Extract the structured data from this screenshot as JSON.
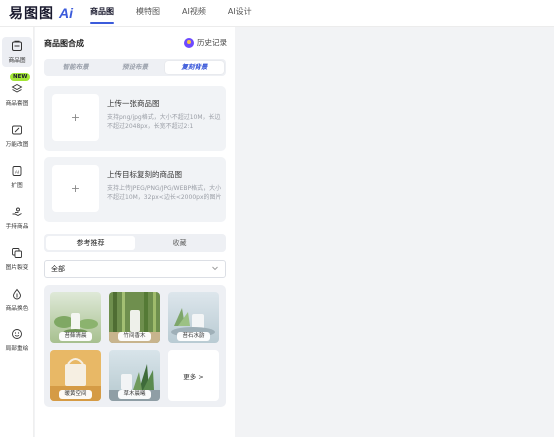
{
  "app": {
    "logo_text": "易图图",
    "logo_ai": "Ai"
  },
  "nav": {
    "items": [
      {
        "label": "商品图",
        "active": true
      },
      {
        "label": "模特图",
        "active": false
      },
      {
        "label": "AI视频",
        "active": false
      },
      {
        "label": "AI设计",
        "active": false
      }
    ]
  },
  "sidebar": {
    "new_badge": "NEW",
    "items": [
      {
        "label": "商品图",
        "icon": "product-image-icon",
        "active": true
      },
      {
        "label": "商品套图",
        "icon": "image-set-icon",
        "active": false
      },
      {
        "label": "万能改图",
        "icon": "edit-image-icon",
        "active": false
      },
      {
        "label": "扩图",
        "icon": "expand-image-icon",
        "active": false
      },
      {
        "label": "手持商品",
        "icon": "hand-hold-icon",
        "active": false
      },
      {
        "label": "图片裂变",
        "icon": "image-variation-icon",
        "active": false
      },
      {
        "label": "商品换色",
        "icon": "recolor-icon",
        "active": false
      },
      {
        "label": "局部重绘",
        "icon": "inpaint-icon",
        "active": false
      }
    ]
  },
  "panel": {
    "title": "商品图合成",
    "history_label": "历史记录",
    "modes": [
      {
        "label": "智能布景",
        "active": false
      },
      {
        "label": "预设布景",
        "active": false
      },
      {
        "label": "复刻背景",
        "active": true
      }
    ],
    "upload_product": {
      "title": "上传一张商品图",
      "desc": "支持png/jpg格式，大小不超过10M，长边不超过2048px，长宽不超过2:1",
      "plus": "+"
    },
    "upload_reference": {
      "title": "上传目标复刻的商品图",
      "desc": "支持上传JPEG/PNG/JPG/WEBP格式，大小不超过10M，32px<边长<2000px的图片",
      "plus": "+"
    },
    "tabs": [
      {
        "label": "参考推荐",
        "active": true
      },
      {
        "label": "收藏",
        "active": false
      }
    ],
    "filter": {
      "selected": "全部"
    },
    "references": [
      {
        "caption": "苔藓清晨"
      },
      {
        "caption": "竹间香木"
      },
      {
        "caption": "苔石水韵"
      },
      {
        "caption": "暖黄空间"
      },
      {
        "caption": "草木晨曦"
      }
    ],
    "more_label": "更多 >"
  },
  "colors": {
    "accent": "#3b5bdb",
    "badge": "#a3e635",
    "history_icon": "#6d4aff"
  }
}
